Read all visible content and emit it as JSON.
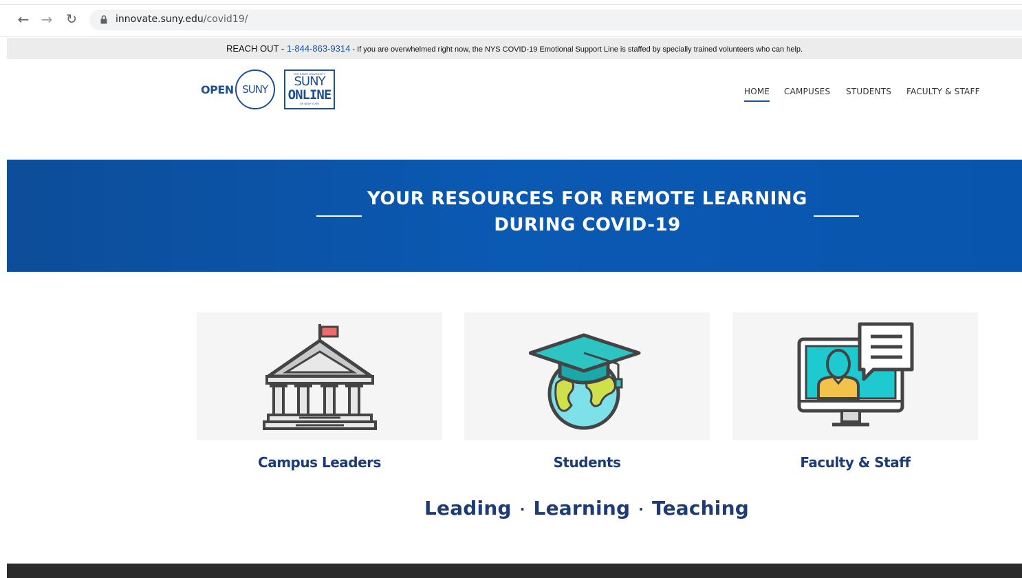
{
  "browser": {
    "url_domain": "innovate.suny.edu",
    "url_path": "/covid19/",
    "back_icon": "arrow-left-icon",
    "forward_icon": "arrow-right-icon",
    "reload_icon": "reload-icon",
    "lock_icon": "lock-icon"
  },
  "banner": {
    "lead": "REACH OUT - ",
    "phone": "1-844-863-9314",
    "message": " - If you are overwhelmed right now, the NYS COVID-19 Emotional Support Line is staffed by specially trained volunteers who can help."
  },
  "header": {
    "logo_open_word": "OPEN",
    "logo_open_circle": "SUNY",
    "logo_online_small": "THE STATE UNIVERSITY",
    "logo_online_top": "SUNY",
    "logo_online_bottom": "ONLINE",
    "logo_online_tiny": "OF NEW YORK",
    "nav": {
      "home": "HOME",
      "campuses": "CAMPUSES",
      "students": "STUDENTS",
      "faculty": "FACULTY & STAFF"
    }
  },
  "hero": {
    "line1": "YOUR RESOURCES FOR REMOTE LEARNING",
    "line2": "DURING COVID-19"
  },
  "cards": [
    {
      "label": "Campus Leaders",
      "icon": "university-building-icon"
    },
    {
      "label": "Students",
      "icon": "graduation-cap-globe-icon"
    },
    {
      "label": "Faculty & Staff",
      "icon": "video-chat-monitor-icon"
    }
  ],
  "tagline": {
    "word1": "Leading",
    "word2": "Learning",
    "word3": "Teaching",
    "separator": "·"
  },
  "colors": {
    "brand_blue": "#1d4f91",
    "hero_blue": "#0a59b3",
    "heading_navy": "#1d3c73",
    "footer": "#2b2b2b"
  }
}
